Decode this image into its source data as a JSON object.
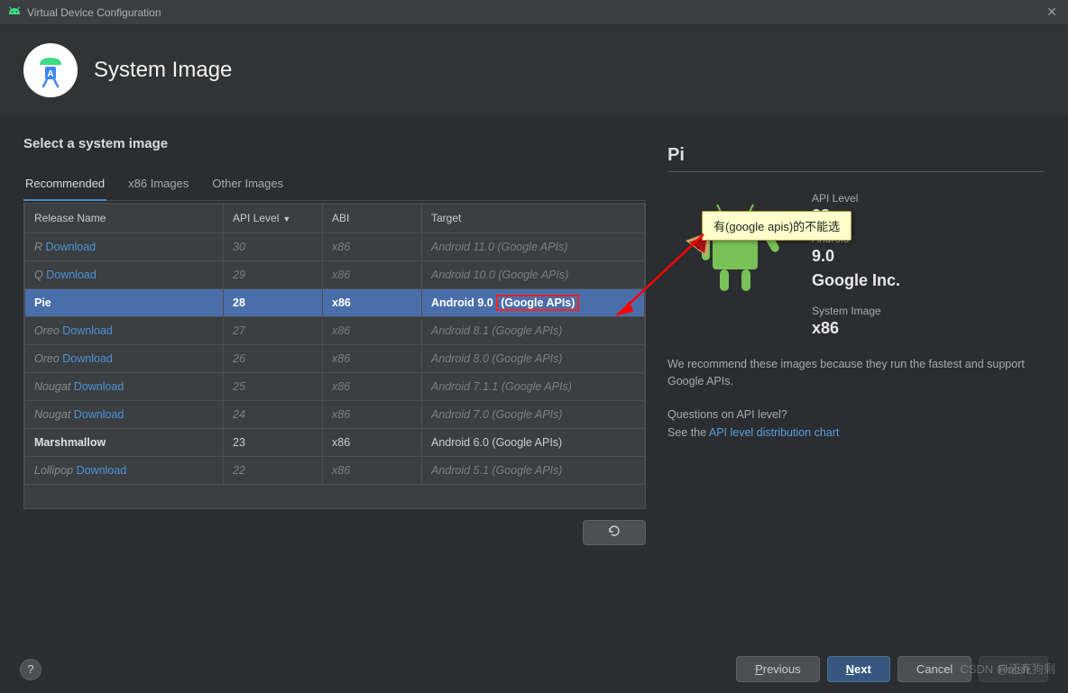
{
  "window": {
    "title": "Virtual Device Configuration"
  },
  "header": {
    "title": "System Image"
  },
  "subtitle": "Select a system image",
  "tabs": [
    {
      "label": "Recommended",
      "active": true
    },
    {
      "label": "x86 Images",
      "active": false
    },
    {
      "label": "Other Images",
      "active": false
    }
  ],
  "columns": {
    "release": "Release Name",
    "api": "API Level",
    "abi": "ABI",
    "target": "Target"
  },
  "rows": [
    {
      "release_prefix": "R",
      "download": "Download",
      "api": "30",
      "abi": "x86",
      "target": "Android 11.0 (Google APIs)",
      "dim": true
    },
    {
      "release_prefix": "Q",
      "download": "Download",
      "api": "29",
      "abi": "x86",
      "target": "Android 10.0 (Google APIs)",
      "dim": true
    },
    {
      "release_prefix": "Pie",
      "download": "",
      "api": "28",
      "abi": "x86",
      "target_pre": "Android 9.0 ",
      "target_box": "(Google APIs)",
      "selected": true
    },
    {
      "release_prefix": "Oreo",
      "download": "Download",
      "api": "27",
      "abi": "x86",
      "target": "Android 8.1 (Google APIs)",
      "dim": true
    },
    {
      "release_prefix": "Oreo",
      "download": "Download",
      "api": "26",
      "abi": "x86",
      "target": "Android 8.0 (Google APIs)",
      "dim": true
    },
    {
      "release_prefix": "Nougat",
      "download": "Download",
      "api": "25",
      "abi": "x86",
      "target": "Android 7.1.1 (Google APIs)",
      "dim": true
    },
    {
      "release_prefix": "Nougat",
      "download": "Download",
      "api": "24",
      "abi": "x86",
      "target": "Android 7.0 (Google APIs)",
      "dim": true
    },
    {
      "release_prefix": "Marshmallow",
      "download": "",
      "api": "23",
      "abi": "x86",
      "target": "Android 6.0 (Google APIs)",
      "bold": true
    },
    {
      "release_prefix": "Lollipop",
      "download": "Download",
      "api": "22",
      "abi": "x86",
      "target": "Android 5.1 (Google APIs)",
      "dim": true
    }
  ],
  "details": {
    "heading_prefix": "Pi",
    "api_label": "API Level",
    "api_value": "28",
    "android_label": "Android",
    "android_value": "9.0",
    "vendor": "Google Inc.",
    "sys_label": "System Image",
    "sys_value": "x86",
    "desc": "We recommend these images because they run the fastest and support Google APIs.",
    "question": "Questions on API level?",
    "see_the": "See the ",
    "chart_link": "API level distribution chart"
  },
  "tooltip": "有(google apis)的不能选",
  "footer": {
    "previous": "Previous",
    "next": "Next",
    "cancel": "Cancel",
    "finish": "Finish"
  },
  "watermark": "CSDN @迈克狗剩"
}
